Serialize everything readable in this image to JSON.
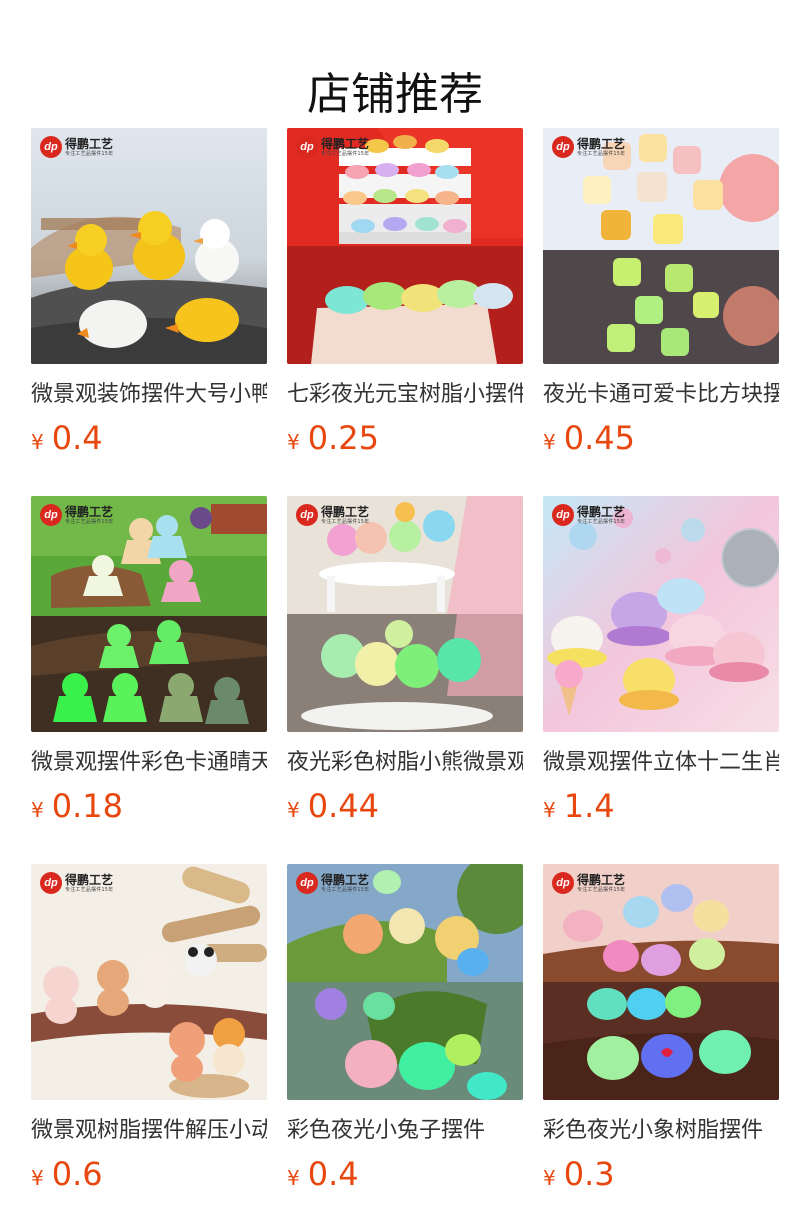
{
  "page": {
    "title": "店铺推荐"
  },
  "brand": {
    "logo_mark": "dp",
    "name": "得鹏工艺",
    "tagline": "专注工艺品摆件15年"
  },
  "theme": {
    "price_color": "#e8470f",
    "title_color": "#111111",
    "text_color": "#333333"
  },
  "products": [
    {
      "name": "微景观装饰摆件大号小鸭子",
      "currency": "¥",
      "price": "0.4",
      "image": "yellow-white-ducks-photo"
    },
    {
      "name": "七彩夜光元宝树脂小摆件",
      "currency": "¥",
      "price": "0.25",
      "image": "glowing-gold-ingots-photo"
    },
    {
      "name": "夜光卡通可爱卡比方块摆件",
      "currency": "¥",
      "price": "0.45",
      "image": "glowing-cartoon-cubes-photo"
    },
    {
      "name": "微景观摆件彩色卡通晴天娃娃",
      "currency": "¥",
      "price": "0.18",
      "image": "glowing-sunny-dolls-photo"
    },
    {
      "name": "夜光彩色树脂小熊微景观",
      "currency": "¥",
      "price": "0.44",
      "image": "glowing-colorful-bears-photo"
    },
    {
      "name": "微景观摆件立体十二生肖",
      "currency": "¥",
      "price": "1.4",
      "image": "pastel-zodiac-animals-photo"
    },
    {
      "name": "微景观树脂摆件解压小动物",
      "currency": "¥",
      "price": "0.6",
      "image": "resin-animals-on-wood-photo"
    },
    {
      "name": "彩色夜光小兔子摆件",
      "currency": "¥",
      "price": "0.4",
      "image": "glowing-bunnies-photo"
    },
    {
      "name": "彩色夜光小象树脂摆件",
      "currency": "¥",
      "price": "0.3",
      "image": "glowing-elephants-photo"
    }
  ]
}
